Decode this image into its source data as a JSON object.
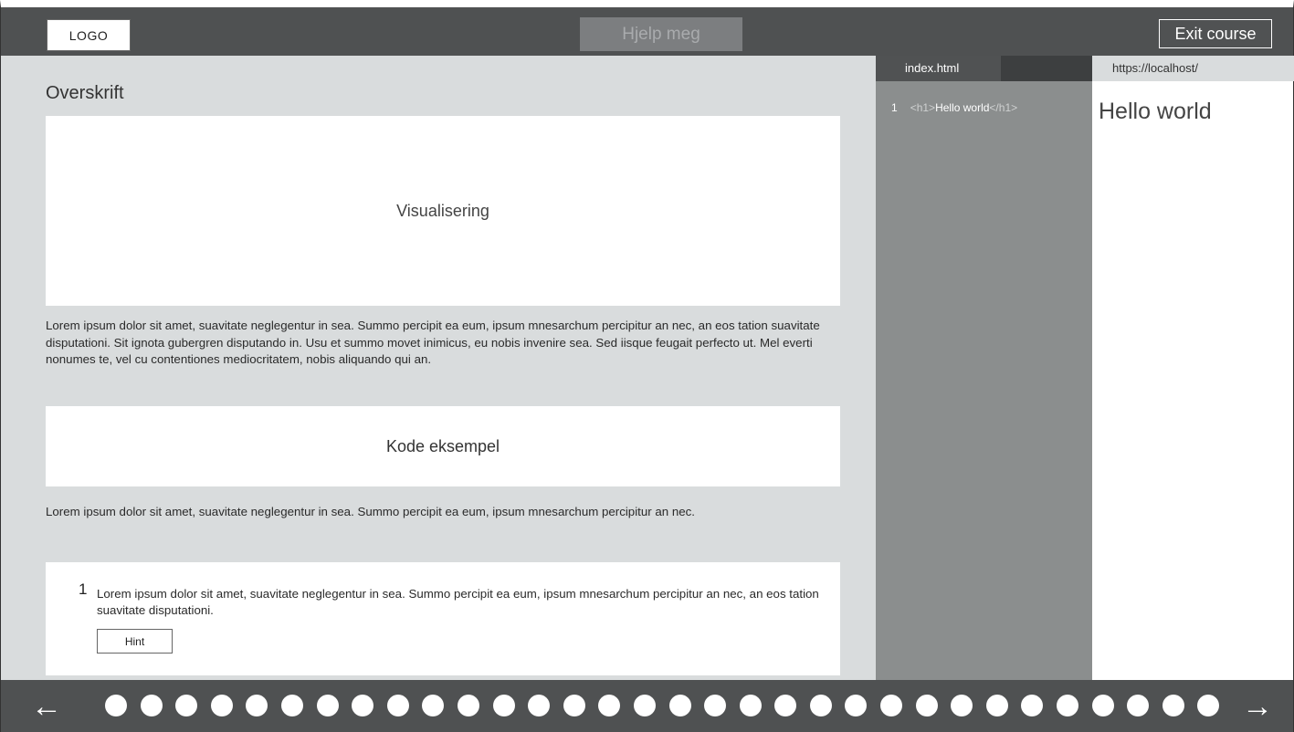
{
  "header": {
    "logo_label": "LOGO",
    "help_label": "Hjelp meg",
    "exit_label": "Exit course"
  },
  "lesson": {
    "title": "Overskrift",
    "visualization_label": "Visualisering",
    "paragraph1": "Lorem ipsum dolor sit amet, suavitate neglegentur in sea. Summo percipit ea eum, ipsum mnesarchum percipitur an nec, an eos tation suavitate disputationi. Sit ignota gubergren disputando in. Usu et summo movet inimicus, eu nobis invenire sea. Sed iisque feugait perfecto ut. Mel everti nonumes te, vel cu contentiones mediocritatem, nobis aliquando qui an.",
    "code_example_label": "Kode eksempel",
    "paragraph2": "Lorem ipsum dolor sit amet, suavitate neglegentur in sea. Summo percipit ea eum, ipsum mnesarchum percipitur an nec.",
    "task": {
      "number": "1",
      "text": "Lorem ipsum dolor sit amet, suavitate neglegentur in sea. Summo percipit ea eum, ipsum mnesarchum percipitur an nec, an eos tation suavitate disputationi.",
      "hint_label": "Hint"
    }
  },
  "editor": {
    "tab_label": "index.html",
    "line_number": "1",
    "open_tag": "<h1>",
    "content": "Hello world",
    "close_tag": "</h1>"
  },
  "preview": {
    "url": "https://localhost/",
    "heading": "Hello world"
  },
  "navigation": {
    "prev_icon": "arrow-left-icon",
    "next_icon": "arrow-right-icon",
    "prev_glyph": "←",
    "next_glyph": "→",
    "step_count": 32
  }
}
